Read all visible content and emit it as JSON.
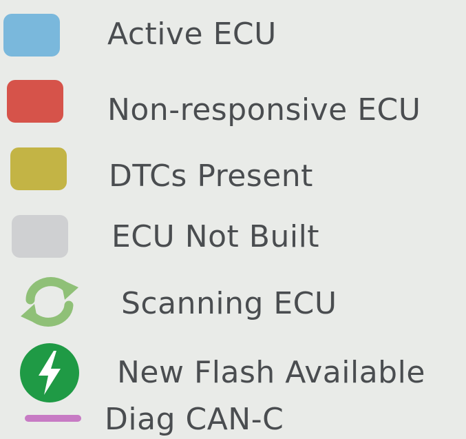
{
  "legend": {
    "items": [
      {
        "label": "Active ECU",
        "color": "#7ab8dc",
        "icon": "active-ecu-swatch"
      },
      {
        "label": "Non-responsive ECU",
        "color": "#d6534a",
        "icon": "non-responsive-ecu-swatch"
      },
      {
        "label": "DTCs Present",
        "color": "#c3b445",
        "icon": "dtcs-present-swatch"
      },
      {
        "label": "ECU Not Built",
        "color": "#cfd0d2",
        "icon": "ecu-not-built-swatch"
      },
      {
        "label": "Scanning ECU",
        "color": "#8fc077",
        "icon": "refresh-arrows-icon"
      },
      {
        "label": "New Flash Available",
        "color": "#1f9a45",
        "icon": "lightning-bolt-icon"
      },
      {
        "label": "Diag CAN-C",
        "color": "#c77bc4",
        "icon": "line-swatch"
      }
    ]
  }
}
